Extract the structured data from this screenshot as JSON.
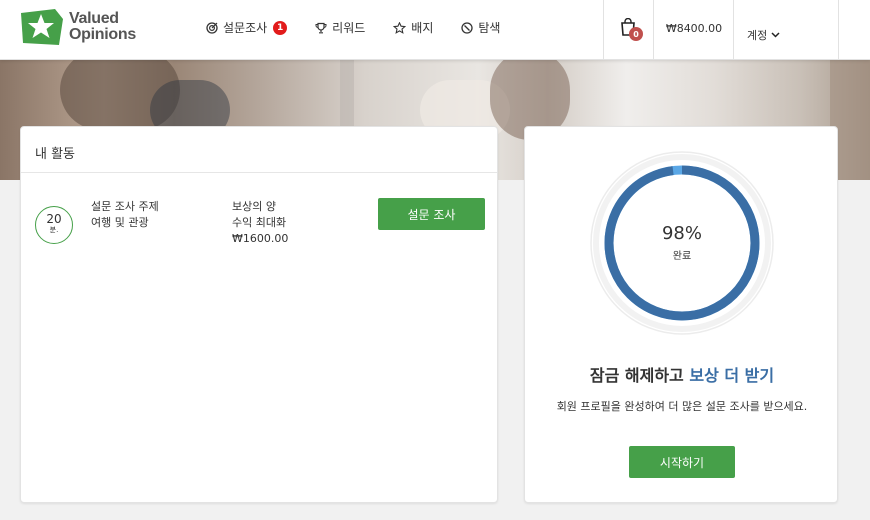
{
  "brand": {
    "line1": "Valued",
    "line2": "Opinions"
  },
  "nav": [
    {
      "label": "설문조사",
      "icon": "target-icon",
      "badge": "1"
    },
    {
      "label": "리워드",
      "icon": "trophy-icon"
    },
    {
      "label": "배지",
      "icon": "star-icon"
    },
    {
      "label": "탐색",
      "icon": "compass-icon"
    }
  ],
  "cart": {
    "count": "0",
    "icon": "shopping-bag-icon"
  },
  "balance": "₩8400.00",
  "account": {
    "label": "계정",
    "icon": "chevron-down-icon"
  },
  "activity": {
    "title": "내 활동",
    "item": {
      "duration": "20",
      "duration_unit": "분.",
      "topic_label": "설문 조사 주제",
      "topic_value": "여행 및 관광",
      "reward_label": "보상의 양",
      "reward_note": "수익 최대화",
      "reward_value": "₩1600.00",
      "button": "설문 조사"
    }
  },
  "profile": {
    "percent": 98,
    "percent_label": "98%",
    "complete_label": "완료",
    "title_prefix": "잠금 해제하고",
    "title_highlight": "보상 더 받기",
    "description": "회원 프로필을 완성하여 더 많은 설문 조사를 받으세요.",
    "button": "시작하기"
  },
  "colors": {
    "accent_green": "#46a049",
    "ring_blue": "#3a6ea5",
    "ring_remaining": "#5aa7e6",
    "badge_red": "#e21b1b"
  }
}
